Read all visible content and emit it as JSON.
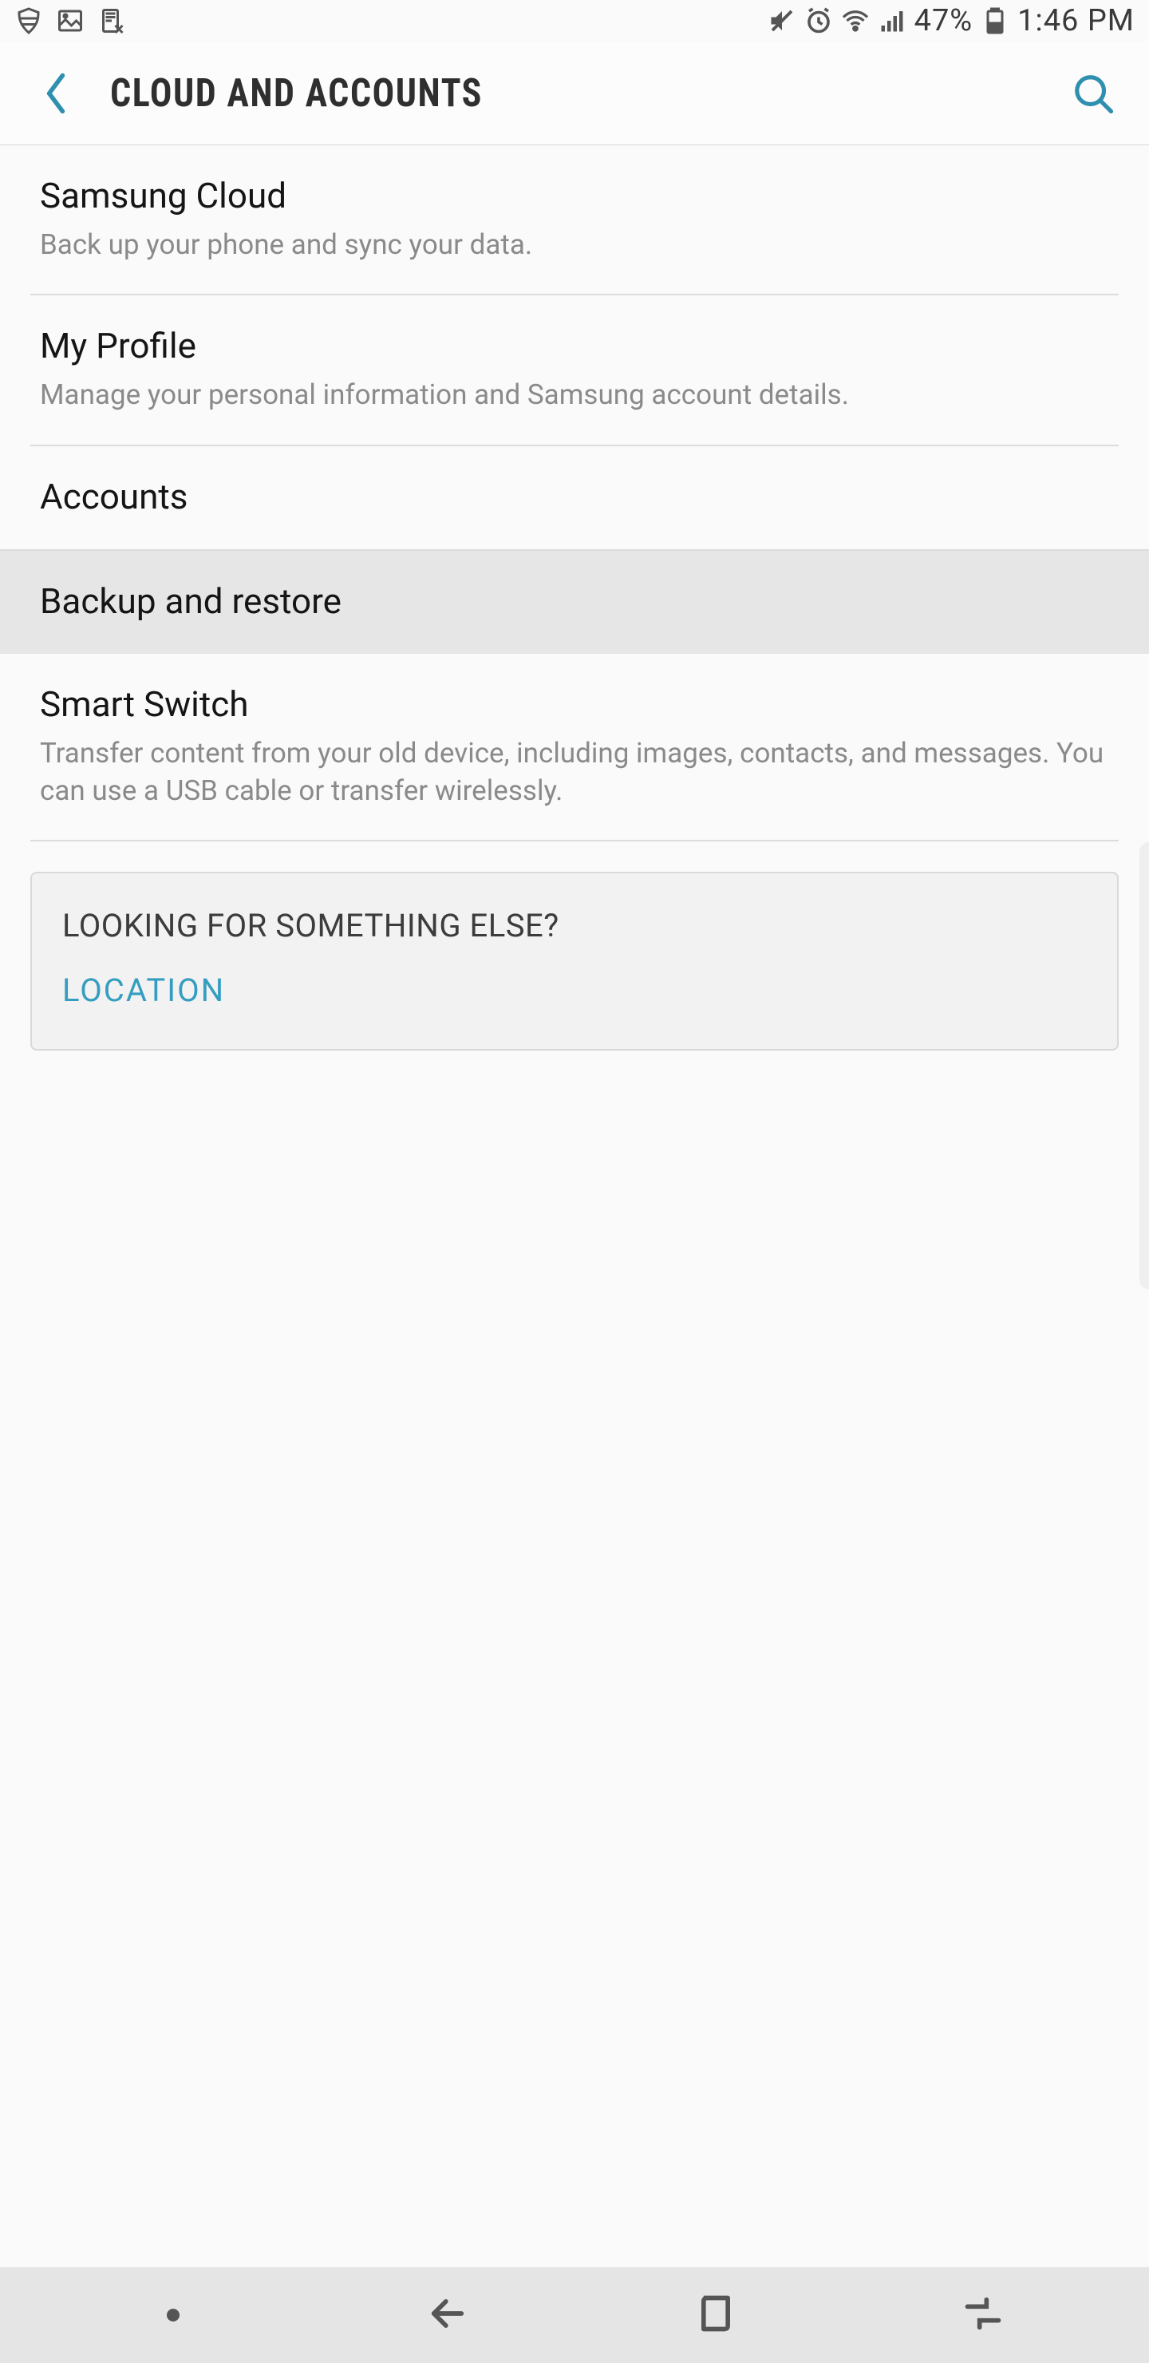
{
  "status": {
    "battery": "47%",
    "time": "1:46 PM"
  },
  "appbar": {
    "title": "CLOUD AND ACCOUNTS"
  },
  "list": {
    "samsung_cloud": {
      "title": "Samsung Cloud",
      "sub": "Back up your phone and sync your data."
    },
    "my_profile": {
      "title": "My Profile",
      "sub": "Manage your personal information and Samsung account details."
    },
    "accounts": {
      "title": "Accounts"
    },
    "backup_restore": {
      "title": "Backup and restore"
    },
    "smart_switch": {
      "title": "Smart Switch",
      "sub": "Transfer content from your old device, including images, contacts, and messages. You can use a USB cable or transfer wirelessly."
    }
  },
  "card": {
    "title": "LOOKING FOR SOMETHING ELSE?",
    "link": "LOCATION"
  }
}
